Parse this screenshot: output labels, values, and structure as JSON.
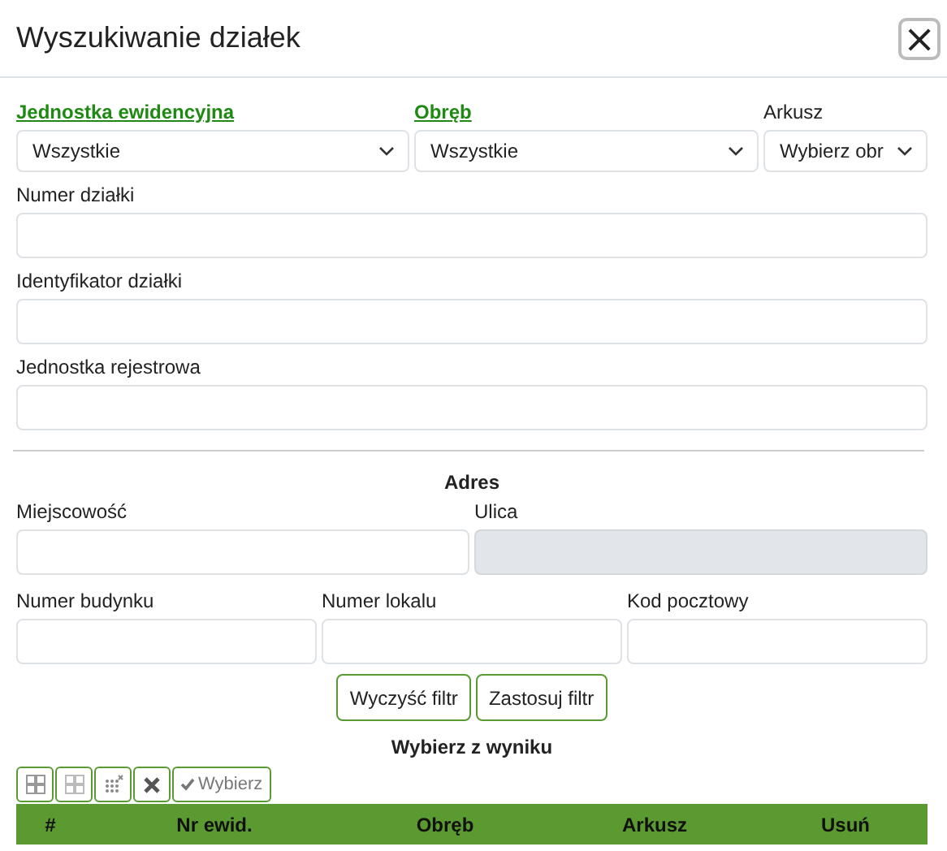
{
  "window": {
    "title": "Wyszukiwanie działek",
    "close": "×"
  },
  "top_fields": [
    {
      "label": "Jednostka ewidencyjna",
      "kind": "select",
      "value": "Wszystkie",
      "required": true
    },
    {
      "label": "Obręb",
      "kind": "select",
      "value": "Wszystkie",
      "required": true
    },
    {
      "label": "Arkusz",
      "kind": "select",
      "value": "Wybierz obr",
      "required": false
    }
  ],
  "text_fields": [
    {
      "label": "Numer działki"
    },
    {
      "label": "Identyfikator działki"
    },
    {
      "label": "Jednostka rejestrowa"
    }
  ],
  "address": {
    "title": "Adres",
    "row_1": [
      {
        "label": "Miejscowość",
        "disabled": false
      },
      {
        "label": "Ulica",
        "disabled": true
      }
    ],
    "row_2": [
      {
        "label": "Numer budynku",
        "disabled": false
      },
      {
        "label": "Numer lokalu",
        "disabled": false
      },
      {
        "label": "Kod pocztowy",
        "disabled": false
      }
    ]
  },
  "buttons": [
    "Wyczyść filtr",
    "Zastosuj filtr"
  ],
  "results": {
    "title": "Wybierz z wyniku",
    "toolbar": [
      {
        "kind": "select-all"
      },
      {
        "kind": "grid"
      },
      {
        "kind": "clear-selection"
      },
      {
        "kind": "delete"
      },
      {
        "kind": "choose",
        "label": "Wybierz"
      }
    ],
    "columns": [
      "#",
      "Nr ewid.",
      "Obręb",
      "Arkusz",
      "Usuń"
    ]
  }
}
